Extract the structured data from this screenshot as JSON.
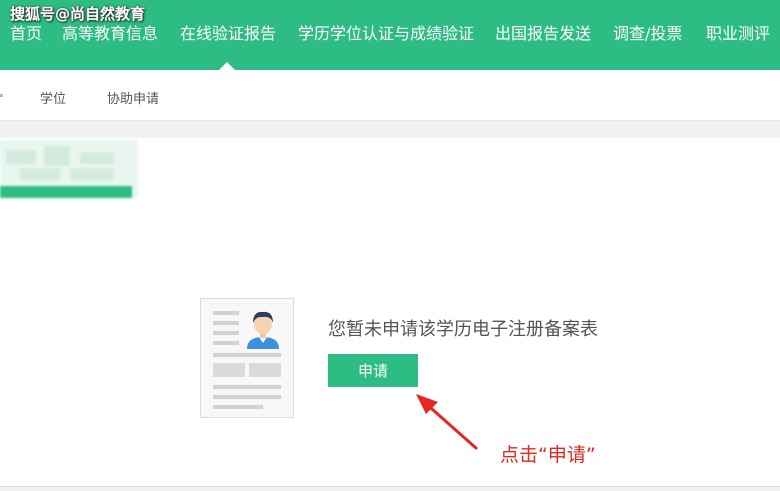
{
  "watermark": "搜狐号@尚自然教育",
  "nav": {
    "items": [
      {
        "label": "首页"
      },
      {
        "label": "高等教育信息"
      },
      {
        "label": "在线验证报告"
      },
      {
        "label": "学历学位认证与成绩验证"
      },
      {
        "label": "出国报告发送"
      },
      {
        "label": "调查/投票"
      },
      {
        "label": "职业测评"
      }
    ],
    "active": "在线验证报告"
  },
  "subnav": {
    "items": [
      {
        "label": "学位"
      },
      {
        "label": "协助申请"
      }
    ]
  },
  "main": {
    "empty_message": "您暂未申请该学历电子注册备案表",
    "apply_label": "申请"
  },
  "annotation": {
    "text": "点击“申请”",
    "color": "#e7261d"
  },
  "colors": {
    "brand": "#2dbd84",
    "annotation": "#e7261d"
  },
  "icons": [
    "document-avatar-icon",
    "arrow-icon"
  ]
}
